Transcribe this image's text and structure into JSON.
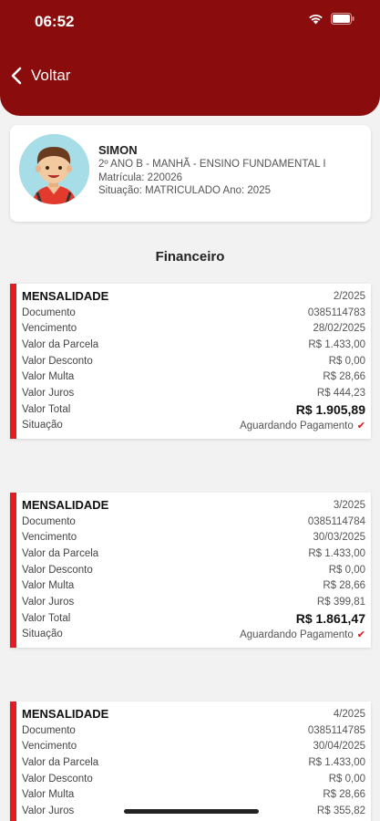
{
  "status_bar": {
    "time": "06:52"
  },
  "header": {
    "back_label": "Voltar"
  },
  "student": {
    "name": "SIMON",
    "class_line": "2º ANO B - MANHÃ - ENSINO FUNDAMENTAL I",
    "matricula_line": "Matrícula: 220026",
    "situacao_line": "Situação: MATRICULADO Ano: 2025"
  },
  "section_title": "Financeiro",
  "labels": {
    "documento": "Documento",
    "vencimento": "Vencimento",
    "valor_parcela": "Valor da Parcela",
    "valor_desconto": "Valor Desconto",
    "valor_multa": "Valor Multa",
    "valor_juros": "Valor Juros",
    "valor_total": "Valor Total",
    "situacao": "Situação"
  },
  "cards": [
    {
      "type": "MENSALIDADE",
      "period": "2/2025",
      "documento": "0385114783",
      "vencimento": "28/02/2025",
      "valor_parcela": "R$ 1.433,00",
      "valor_desconto": "R$ 0,00",
      "valor_multa": "R$ 28,66",
      "valor_juros": "R$ 444,23",
      "valor_total": "R$ 1.905,89",
      "situacao": "Aguardando Pagamento"
    },
    {
      "type": "MENSALIDADE",
      "period": "3/2025",
      "documento": "0385114784",
      "vencimento": "30/03/2025",
      "valor_parcela": "R$ 1.433,00",
      "valor_desconto": "R$ 0,00",
      "valor_multa": "R$ 28,66",
      "valor_juros": "R$ 399,81",
      "valor_total": "R$ 1.861,47",
      "situacao": "Aguardando Pagamento"
    },
    {
      "type": "MENSALIDADE",
      "period": "4/2025",
      "documento": "0385114785",
      "vencimento": "30/04/2025",
      "valor_parcela": "R$ 1.433,00",
      "valor_desconto": "R$ 0,00",
      "valor_multa": "R$ 28,66",
      "valor_juros": "R$ 355,82"
    }
  ]
}
